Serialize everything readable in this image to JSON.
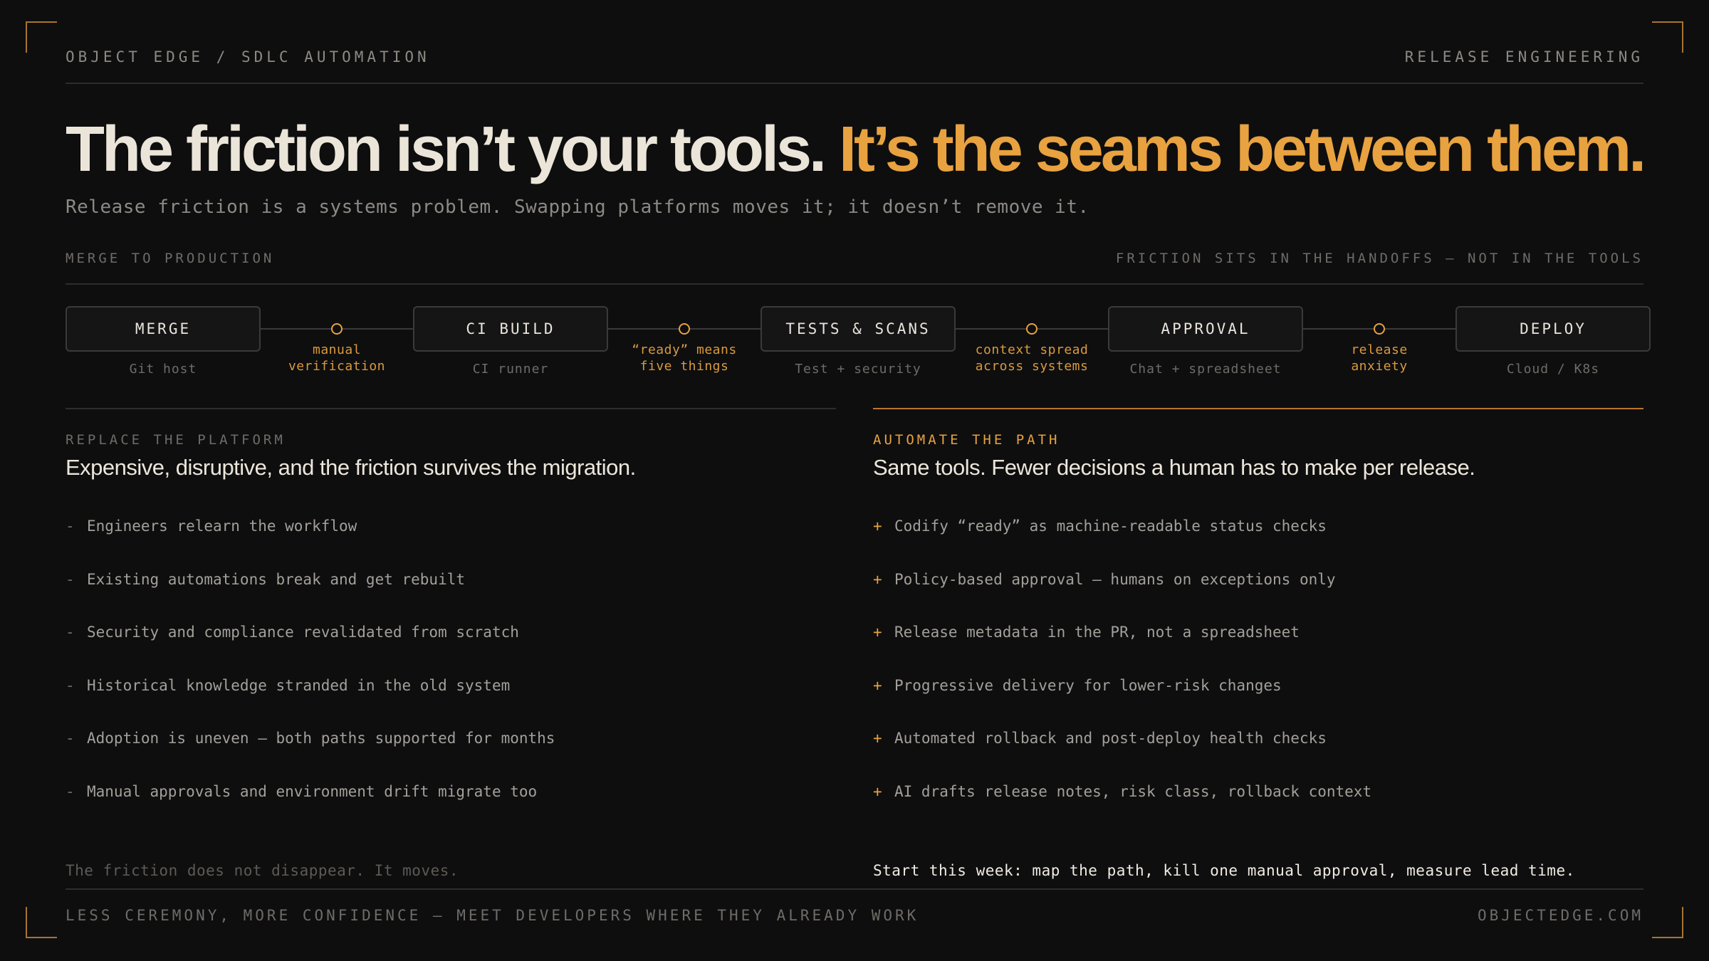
{
  "header": {
    "brand_path": "OBJECT EDGE / SDLC AUTOMATION",
    "section_label": "RELEASE ENGINEERING"
  },
  "headline": {
    "lead": "The friction isn’t your tools. ",
    "accent": "It’s the seams between them."
  },
  "subtitle": "Release friction is a systems problem. Swapping platforms moves it; it doesn’t remove it.",
  "pipeline": {
    "label_left": "MERGE TO PRODUCTION",
    "label_right": "FRICTION SITS IN THE HANDOFFS — NOT IN THE TOOLS",
    "stages": [
      {
        "label": "MERGE",
        "sub": "Git host"
      },
      {
        "label": "CI BUILD",
        "sub": "CI runner"
      },
      {
        "label": "TESTS & SCANS",
        "sub": "Test + security"
      },
      {
        "label": "APPROVAL",
        "sub": "Chat + spreadsheet"
      },
      {
        "label": "DEPLOY",
        "sub": "Cloud / K8s"
      }
    ],
    "seams": [
      {
        "line1": "manual",
        "line2": "verification"
      },
      {
        "line1": "“ready” means",
        "line2": "five things"
      },
      {
        "line1": "context spread",
        "line2": "across systems"
      },
      {
        "line1": "release",
        "line2": "anxiety"
      }
    ]
  },
  "left": {
    "kicker": "REPLACE THE PLATFORM",
    "title": "Expensive, disruptive, and the friction survives the migration.",
    "marker": "-",
    "items": [
      "Engineers relearn the workflow",
      "Existing automations break and get rebuilt",
      "Security and compliance revalidated from scratch",
      "Historical knowledge stranded in the old system",
      "Adoption is uneven — both paths supported for months",
      "Manual approvals and environment drift migrate too"
    ],
    "footer": "The friction does not disappear. It moves."
  },
  "right": {
    "kicker": "AUTOMATE THE PATH",
    "title": "Same tools. Fewer decisions a human has to make per release.",
    "marker": "+",
    "items": [
      "Codify “ready” as machine-readable status checks",
      "Policy-based approval — humans on exceptions only",
      "Release metadata in the PR, not a spreadsheet",
      "Progressive delivery for lower-risk changes",
      "Automated rollback and post-deploy health checks",
      "AI drafts release notes, risk class, rollback context"
    ],
    "footer": "Start this week: map the path, kill one manual approval, measure lead time."
  },
  "footer": {
    "tagline": "LESS CEREMONY, MORE CONFIDENCE — MEET DEVELOPERS WHERE THEY ALREADY WORK",
    "site": "OBJECTEDGE.COM"
  },
  "colors": {
    "background": "#0e0e0f",
    "accent": "#e8a23f",
    "text": "#e8e4dc",
    "muted": "#8d8a84"
  }
}
